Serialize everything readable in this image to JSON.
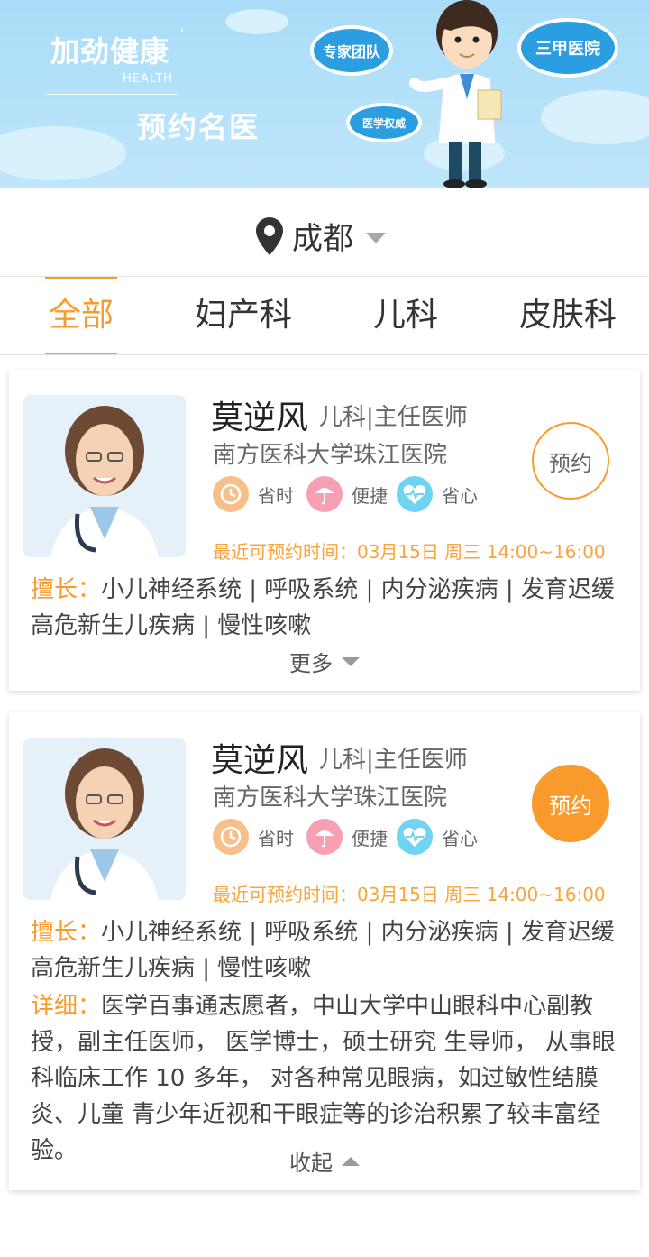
{
  "banner": {
    "title": "加劲健康",
    "title_mark": "'",
    "subtitle": "HEALTH",
    "slogan": "预约名医",
    "bubbles": [
      "专家团队",
      "医学权威",
      "三甲医院"
    ]
  },
  "location": {
    "city": "成都",
    "icon": "location-pin-icon"
  },
  "tabs": [
    {
      "label": "全部",
      "active": true
    },
    {
      "label": "妇产科",
      "active": false
    },
    {
      "label": "儿科",
      "active": false
    },
    {
      "label": "皮肤科",
      "active": false
    }
  ],
  "colors": {
    "accent": "#f99b2c",
    "banner": "#a9dcf8",
    "icon_time": "#f7c08a",
    "icon_convenient": "#f7a0b4",
    "icon_heart": "#6fd3f1"
  },
  "doctors": [
    {
      "name": "莫逆风",
      "title": "儿科|主任医师",
      "hospital": "南方医科大学珠江医院",
      "features": [
        "省时",
        "便捷",
        "省心"
      ],
      "appointment_time": "最近可预约时间：03月15日  周三  14:00~16:00",
      "book_label": "预约",
      "specialty_label": "擅长：",
      "specialty": "小儿神经系统 | 呼吸系统 | 内分泌疾病 | 发育迟缓 高危新生儿疾病 | 慢性咳嗽",
      "toggle_label": "更多"
    },
    {
      "name": "莫逆风",
      "title": "儿科|主任医师",
      "hospital": "南方医科大学珠江医院",
      "features": [
        "省时",
        "便捷",
        "省心"
      ],
      "appointment_time": "最近可预约时间：03月15日  周三  14:00~16:00",
      "book_label": "预约",
      "specialty_label": "擅长：",
      "specialty": "小儿神经系统 | 呼吸系统 | 内分泌疾病 | 发育迟缓 高危新生儿疾病 | 慢性咳嗽",
      "detail_label": "详细：",
      "detail": "医学百事通志愿者，中山大学中山眼科中心副教授，副主任医师， 医学博士，硕士研究 生导师， 从事眼科临床工作 10 多年， 对各种常见眼病，如过敏性结膜炎、儿童 青少年近视和干眼症等的诊治积累了较丰富经验。",
      "toggle_label": "收起"
    }
  ]
}
